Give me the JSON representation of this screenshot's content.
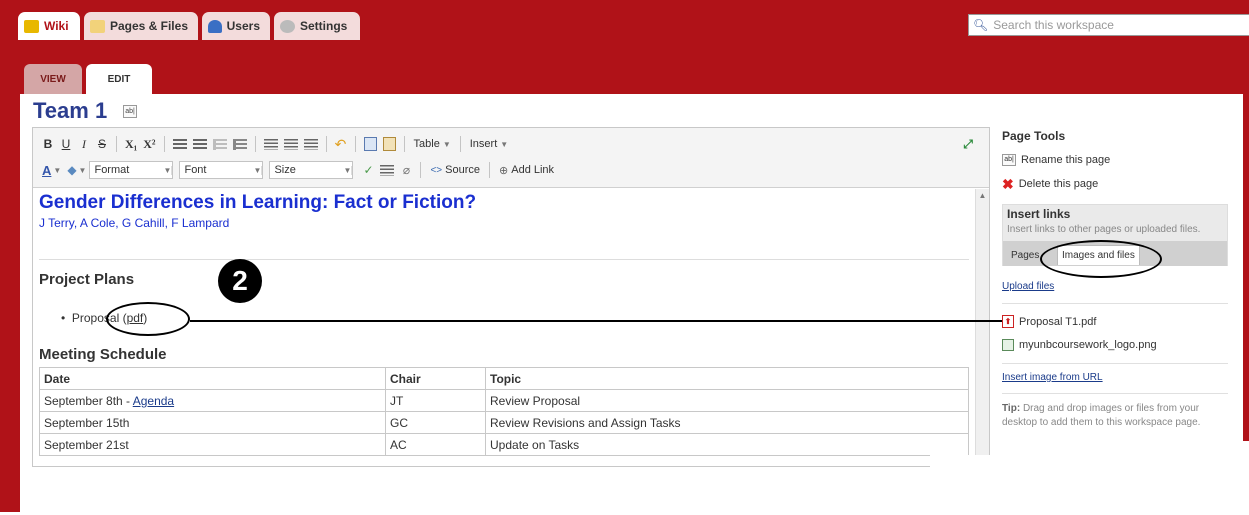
{
  "nav": {
    "tabs": [
      {
        "label": "Wiki",
        "color": "#f0c200"
      },
      {
        "label": "Pages & Files",
        "color": "#e2b24a"
      },
      {
        "label": "Users",
        "color": "#3a6fc4"
      },
      {
        "label": "Settings",
        "color": "#999999"
      }
    ],
    "search_placeholder": "Search this workspace",
    "search_icon": "magnifier-icon"
  },
  "mode_tabs": {
    "view": "VIEW",
    "edit": "EDIT"
  },
  "page": {
    "title": "Team 1",
    "edit_icon_glyph": "ab|"
  },
  "toolbar": {
    "row1": {
      "bold": "B",
      "underline": "U",
      "italic": "I",
      "strike": "S",
      "subscript": "X₁",
      "superscript": "X²",
      "table": "Table",
      "insert": "Insert"
    },
    "row2": {
      "format": "Format",
      "font": "Font",
      "size": "Size",
      "source": "Source",
      "add_link": "Add Link"
    },
    "link_glyph": "⊕"
  },
  "doc": {
    "title": "Gender Differences in Learning:  Fact or Fiction?",
    "authors": "J Terry, A Cole, G Cahill, F Lampard",
    "project_heading": "Project Plans",
    "proposal_text": "Proposal (",
    "proposal_link": "pdf",
    "proposal_close": ")",
    "meeting_heading": "Meeting Schedule",
    "table": {
      "headers": [
        "Date",
        "Chair",
        "Topic"
      ],
      "rows": [
        {
          "date": "September 8th - ",
          "agenda": "Agenda",
          "chair": "JT",
          "topic": "Review Proposal"
        },
        {
          "date": "September 15th",
          "agenda": "",
          "chair": "GC",
          "topic": "Review Revisions and Assign Tasks"
        },
        {
          "date": "September 21st",
          "agenda": "",
          "chair": "AC",
          "topic": "Update on Tasks"
        }
      ]
    }
  },
  "panel": {
    "title": "Page Tools",
    "rename": "Rename this page",
    "delete": "Delete this page",
    "insert_links_title": "Insert links",
    "insert_links_desc": "Insert links to other pages or uploaded files.",
    "tab_pages": "Pages",
    "tab_images": "Images and files",
    "upload": "Upload files",
    "files": [
      "Proposal T1.pdf",
      "myunbcoursework_logo.png"
    ],
    "insert_url": "Insert image from URL",
    "tip_label": "Tip:",
    "tip_text": "Drag and drop images or files from your desktop to add them to this workspace page."
  },
  "annotation": {
    "number": "2"
  },
  "colors": {
    "brand_red": "#b01218",
    "title_blue": "#2b3d8f",
    "doc_blue": "#1a2fd0",
    "link_blue": "#1a3b8a"
  }
}
